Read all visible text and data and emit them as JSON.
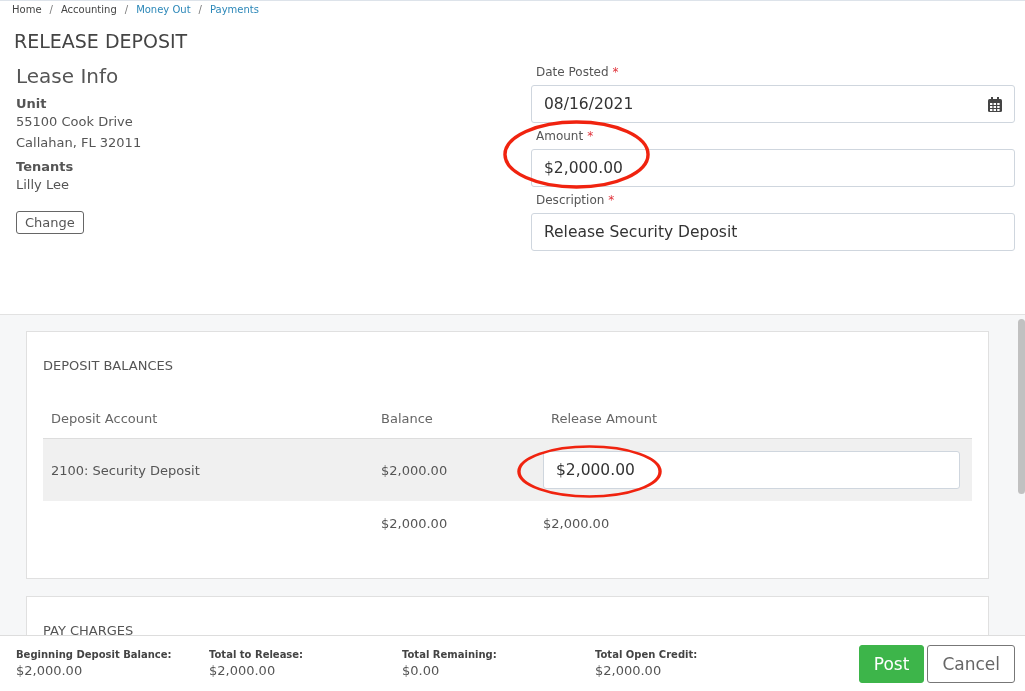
{
  "breadcrumb": [
    {
      "label": "Home",
      "link": false
    },
    {
      "label": "Accounting",
      "link": false
    },
    {
      "label": "Money Out",
      "link": true
    },
    {
      "label": "Payments",
      "link": true
    }
  ],
  "breadcrumb_separator": "/",
  "page_title": "RELEASE DEPOSIT",
  "lease_info": {
    "title": "Lease Info",
    "sections": [
      {
        "heading": "Unit",
        "lines": [
          "55100 Cook Drive",
          "Callahan, FL 32011"
        ]
      },
      {
        "heading": "Tenants",
        "lines": [
          "Lilly Lee"
        ]
      }
    ],
    "button": "Change"
  },
  "fields": [
    {
      "kind": "date",
      "label": "Date Posted",
      "required_mark": "*",
      "value": "08/16/2021",
      "circled": false
    },
    {
      "kind": "text",
      "label": "Amount",
      "required_mark": "*",
      "value": "$2,000.00",
      "circled": true
    },
    {
      "kind": "text",
      "label": "Description",
      "required_mark": "*",
      "value": "Release Security Deposit",
      "circled": false
    }
  ],
  "deposit_balances": {
    "title": "DEPOSIT BALANCES",
    "columns": [
      "Deposit Account",
      "Balance",
      "Release Amount"
    ],
    "rows": [
      {
        "account": "2100: Security Deposit",
        "balance": "$2,000.00",
        "release_amount": "$2,000.00",
        "circled": true
      }
    ],
    "totals": {
      "balance": "$2,000.00",
      "release_amount": "$2,000.00"
    }
  },
  "next_section": {
    "title": "PAY CHARGES"
  },
  "footer": {
    "summaries": [
      {
        "label": "Beginning Deposit Balance:",
        "value": "$2,000.00"
      },
      {
        "label": "Total to Release:",
        "value": "$2,000.00"
      },
      {
        "label": "Total Remaining:",
        "value": "$0.00"
      },
      {
        "label": "Total Open Credit:",
        "value": "$2,000.00"
      }
    ],
    "buttons": [
      {
        "kind": "primary",
        "label": "Post"
      },
      {
        "kind": "secondary",
        "label": "Cancel"
      }
    ]
  }
}
